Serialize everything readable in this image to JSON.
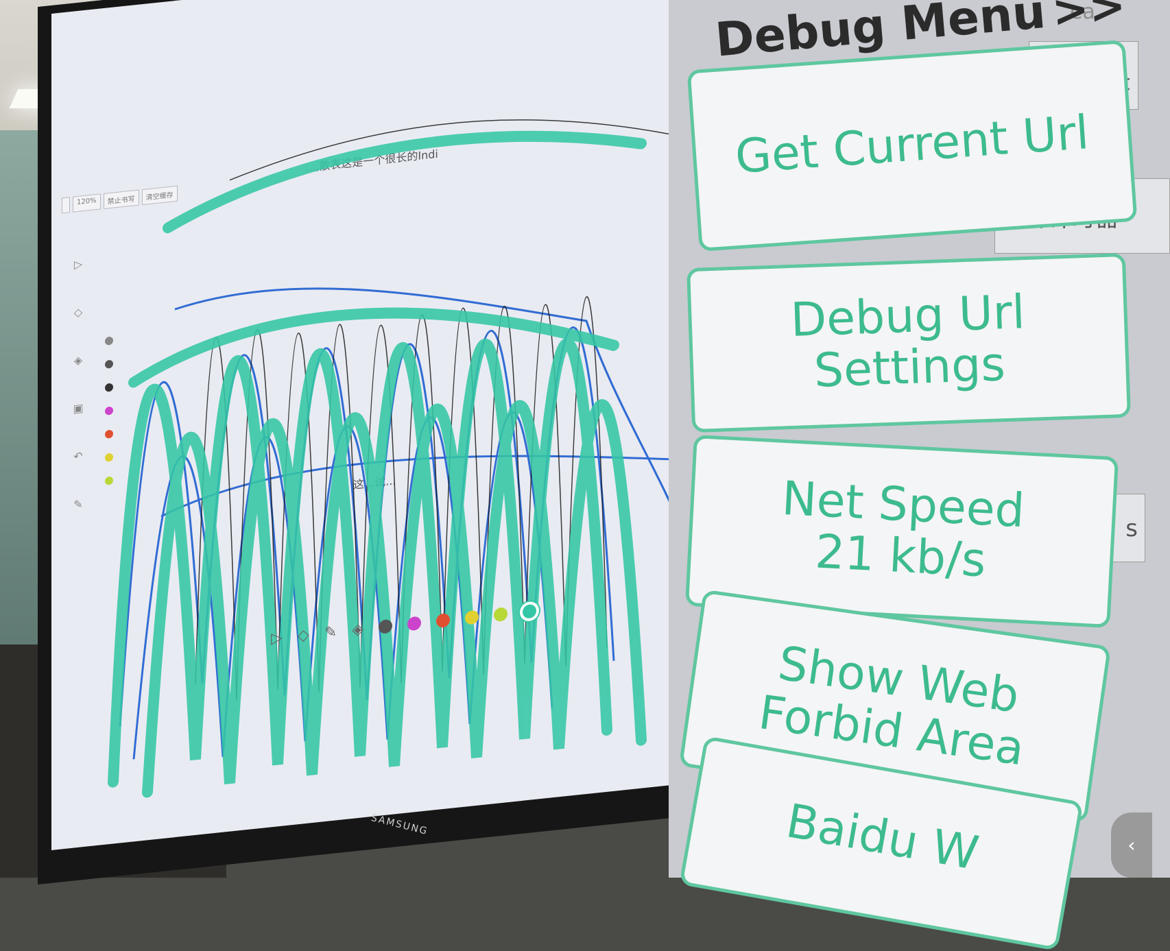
{
  "app": {
    "header": "",
    "toolbar": [
      "",
      "120%",
      "禁止书写",
      "清空缓存"
    ],
    "canvas_notes": [
      "...,散表这是一个很长的Indi",
      "这...试..."
    ]
  },
  "debug_menu": {
    "title": "Debug Menu",
    "arrow": ">>",
    "corner_text": "ea",
    "buttons": {
      "get_current_url": "Get Current Url",
      "debug_url_line1": "Debug Url",
      "debug_url_line2": "Settings",
      "net_speed_line1": "Net Speed",
      "net_speed_line2": "21 kb/s",
      "show_web_line1": "Show Web",
      "show_web_line2": "Forbid Area",
      "baidu": "Baidu W"
    },
    "bg_tabs": [
      "录",
      "展开计时器",
      "s"
    ]
  },
  "monitor": {
    "brand": "SAMSUNG"
  },
  "colors": {
    "accent": "#3dbb8e",
    "border": "#5fc7a0",
    "ink_teal": "#35c7a5",
    "ink_blue": "#1e5fd0",
    "ink_black": "#1a1a1a"
  },
  "palette": [
    "#555555",
    "#cc44cc",
    "#e05030",
    "#e0d030",
    "#b8d838",
    "#35c7a5"
  ]
}
